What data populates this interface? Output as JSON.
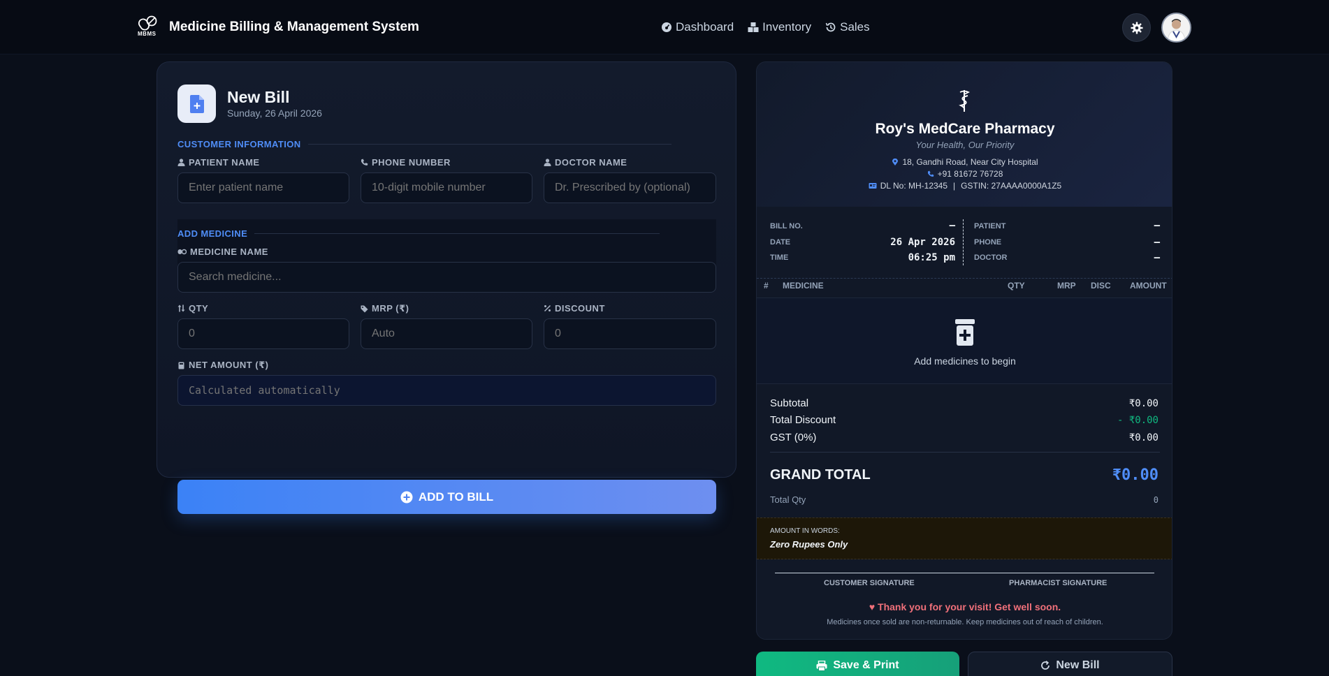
{
  "header": {
    "logo_text": "MBMS",
    "title": "Medicine Billing & Management System",
    "nav": [
      {
        "label": "Dashboard",
        "icon": "dashboard-icon"
      },
      {
        "label": "Inventory",
        "icon": "inventory-icon"
      },
      {
        "label": "Sales",
        "icon": "history-icon"
      }
    ]
  },
  "form": {
    "title": "New Bill",
    "date": "Sunday, 26 April 2026",
    "customer_section": "CUSTOMER INFORMATION",
    "patient_label": "PATIENT NAME",
    "patient_placeholder": "Enter patient name",
    "phone_label": "PHONE NUMBER",
    "phone_placeholder": "10-digit mobile number",
    "doctor_label": "DOCTOR NAME",
    "doctor_placeholder": "Dr. Prescribed by (optional)",
    "medicine_section": "ADD MEDICINE",
    "medicine_label": "MEDICINE NAME",
    "medicine_placeholder": "Search medicine...",
    "qty_label": "QTY",
    "qty_placeholder": "0",
    "mrp_label": "MRP (₹)",
    "mrp_placeholder": "Auto",
    "discount_label": "DISCOUNT",
    "discount_placeholder": "0",
    "net_label": "NET AMOUNT (₹)",
    "net_placeholder": "Calculated automatically",
    "add_button": "ADD TO BILL"
  },
  "receipt": {
    "pharmacy_name": "Roy's MedCare Pharmacy",
    "tagline": "Your Health, Our Priority",
    "address": "18, Gandhi Road, Near City Hospital",
    "phone": "+91 81672 76728",
    "dl": "DL No: MH-12345",
    "gstin": "GSTIN: 27AAAA0000A1Z5",
    "meta": {
      "bill_no_label": "BILL NO.",
      "bill_no": "—",
      "date_label": "DATE",
      "date": "26 Apr 2026",
      "time_label": "TIME",
      "time": "06:25 pm",
      "patient_label": "PATIENT",
      "patient": "—",
      "phone_label": "PHONE",
      "phone": "—",
      "doctor_label": "DOCTOR",
      "doctor": "—"
    },
    "table_headers": [
      "#",
      "MEDICINE",
      "QTY",
      "MRP",
      "DISC",
      "AMOUNT"
    ],
    "empty_text": "Add medicines to begin",
    "subtotal_label": "Subtotal",
    "subtotal": "₹0.00",
    "discount_label": "Total Discount",
    "discount": "- ₹0.00",
    "gst_label": "GST (0%)",
    "gst": "₹0.00",
    "grand_total_label": "GRAND TOTAL",
    "grand_total": "₹0.00",
    "total_qty_label": "Total Qty",
    "total_qty": "0",
    "words_label": "AMOUNT IN WORDS:",
    "words": "Zero Rupees Only",
    "customer_signature": "CUSTOMER SIGNATURE",
    "pharmacist_signature": "PHARMACIST SIGNATURE",
    "thanks": "♥ Thank you for your visit! Get well soon.",
    "note": "Medicines once sold are non-returnable.  Keep medicines out of reach of children."
  },
  "actions": {
    "save_print": "Save & Print",
    "new_bill": "New Bill"
  },
  "colors": {
    "accent": "#4f8df7",
    "success": "#10b981",
    "danger": "#f0707a",
    "background": "#0a0f1a"
  }
}
